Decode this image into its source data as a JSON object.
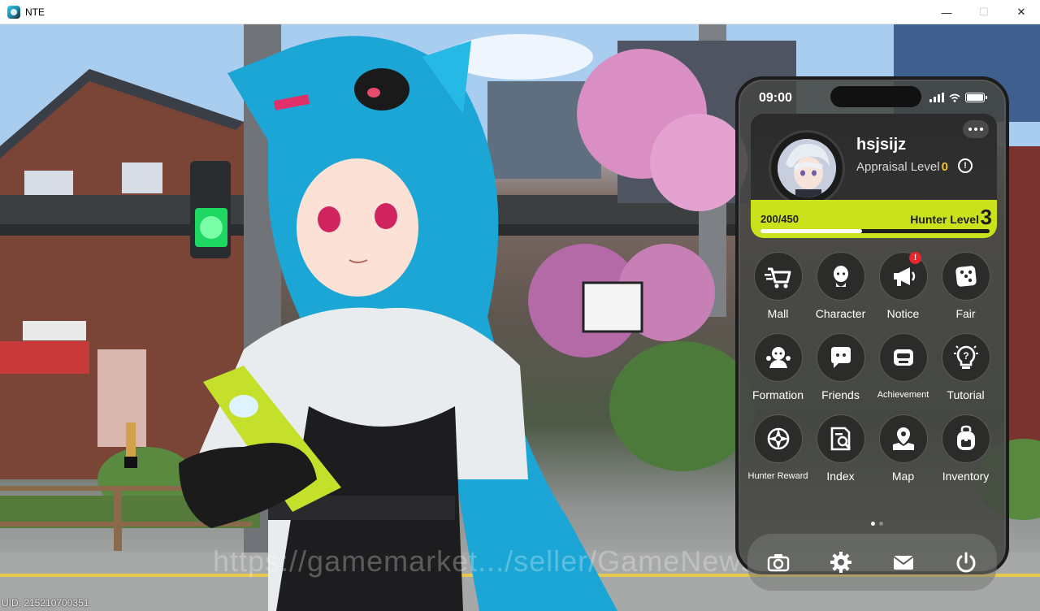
{
  "window": {
    "title": "NTE",
    "minimize": "—",
    "maximize": "☐",
    "close": "✕"
  },
  "phone": {
    "time": "09:00",
    "profile": {
      "username": "hsjsijz",
      "appraisal_label": "Appraisal Level",
      "appraisal_level": "0",
      "exp_text": "200/450",
      "exp_progress": 0.444,
      "hunter_label": "Hunter Level",
      "hunter_level": "3"
    },
    "apps": [
      {
        "label": "Mall",
        "icon": "cart-icon"
      },
      {
        "label": "Character",
        "icon": "character-icon"
      },
      {
        "label": "Notice",
        "icon": "megaphone-icon",
        "badge": "!"
      },
      {
        "label": "Fair",
        "icon": "dice-icon"
      },
      {
        "label": "Formation",
        "icon": "formation-icon"
      },
      {
        "label": "Friends",
        "icon": "chat-bubble-icon"
      },
      {
        "label": "Achievement",
        "icon": "achievement-icon"
      },
      {
        "label": "Tutorial",
        "icon": "lightbulb-icon"
      },
      {
        "label": "Hunter Reward",
        "icon": "compass-star-icon"
      },
      {
        "label": "Index",
        "icon": "index-search-icon"
      },
      {
        "label": "Map",
        "icon": "map-pin-icon"
      },
      {
        "label": "Inventory",
        "icon": "backpack-icon"
      }
    ],
    "dock": [
      "camera-icon",
      "settings-icon",
      "mail-icon",
      "power-icon"
    ],
    "accent": "#c9e21c"
  },
  "overlay": {
    "watermark": "https://gamemarket.../seller/GameNews",
    "uid": "UID: 215210700351"
  }
}
